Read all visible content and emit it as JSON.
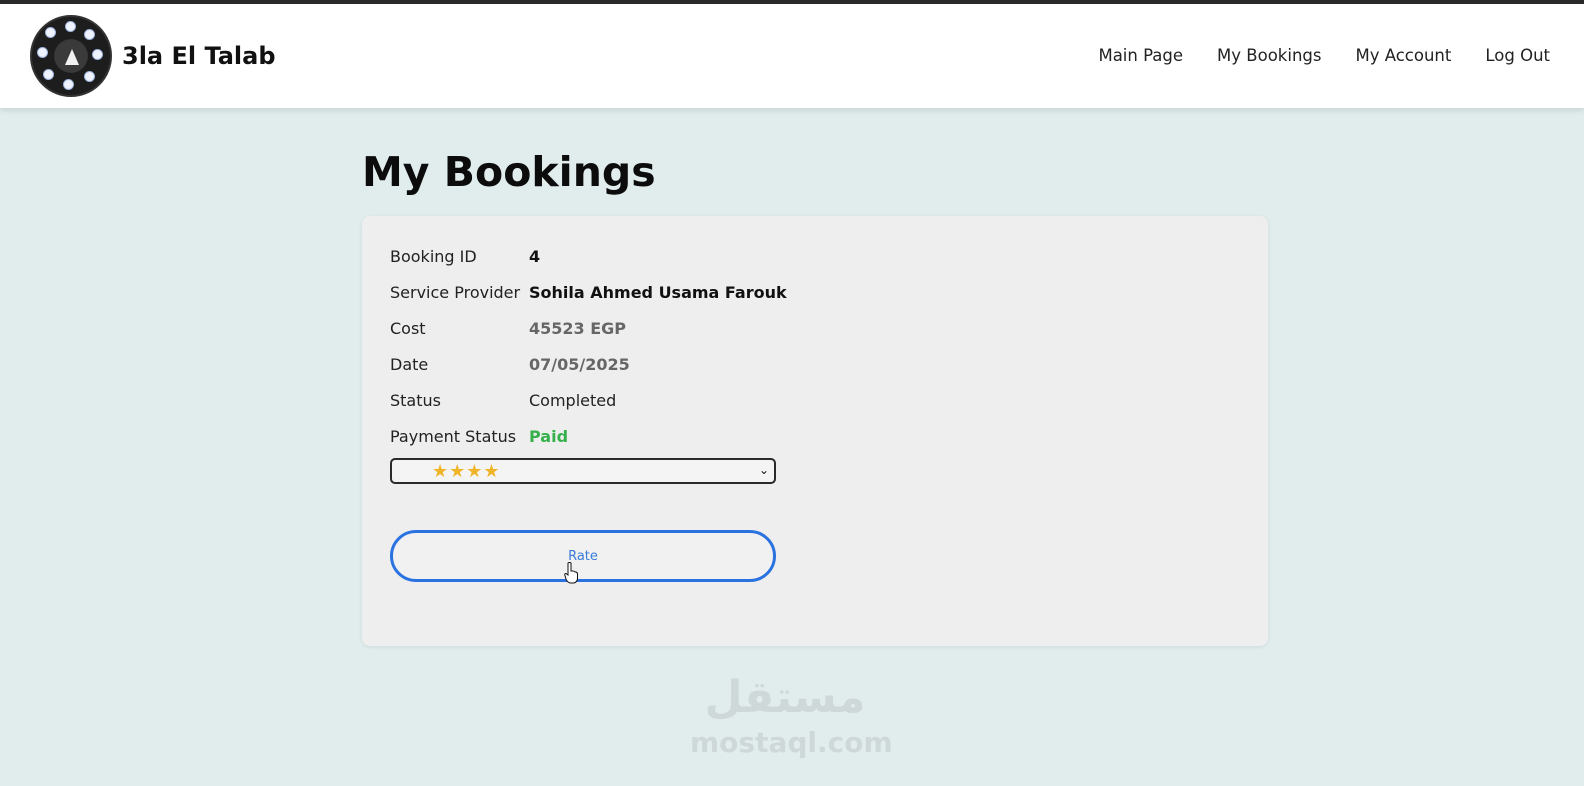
{
  "header": {
    "brand": "3la El Talab",
    "nav": [
      "Main Page",
      "My Bookings",
      "My Account",
      "Log Out"
    ]
  },
  "page": {
    "title": "My Bookings"
  },
  "booking": {
    "fields": [
      {
        "label": "Booking ID",
        "value": "4"
      },
      {
        "label": "Service Provider",
        "value": "Sohila Ahmed Usama Farouk"
      },
      {
        "label": "Cost",
        "value": "45523 EGP"
      },
      {
        "label": "Date",
        "value": "07/05/2025"
      },
      {
        "label": "Status",
        "value": "Completed"
      },
      {
        "label": "Payment Status",
        "value": "Paid"
      }
    ],
    "rating_select": {
      "selected": "★★★★",
      "selected_stars": 4
    },
    "rate_button": "Rate"
  },
  "watermark": {
    "arabic": "مستقل",
    "latin": "mostaql.com"
  },
  "colors": {
    "background": "#e1eded",
    "card": "#eeeeee",
    "paid": "#35b04a",
    "button_border": "#2a72e0",
    "stars": "#f0b429"
  }
}
